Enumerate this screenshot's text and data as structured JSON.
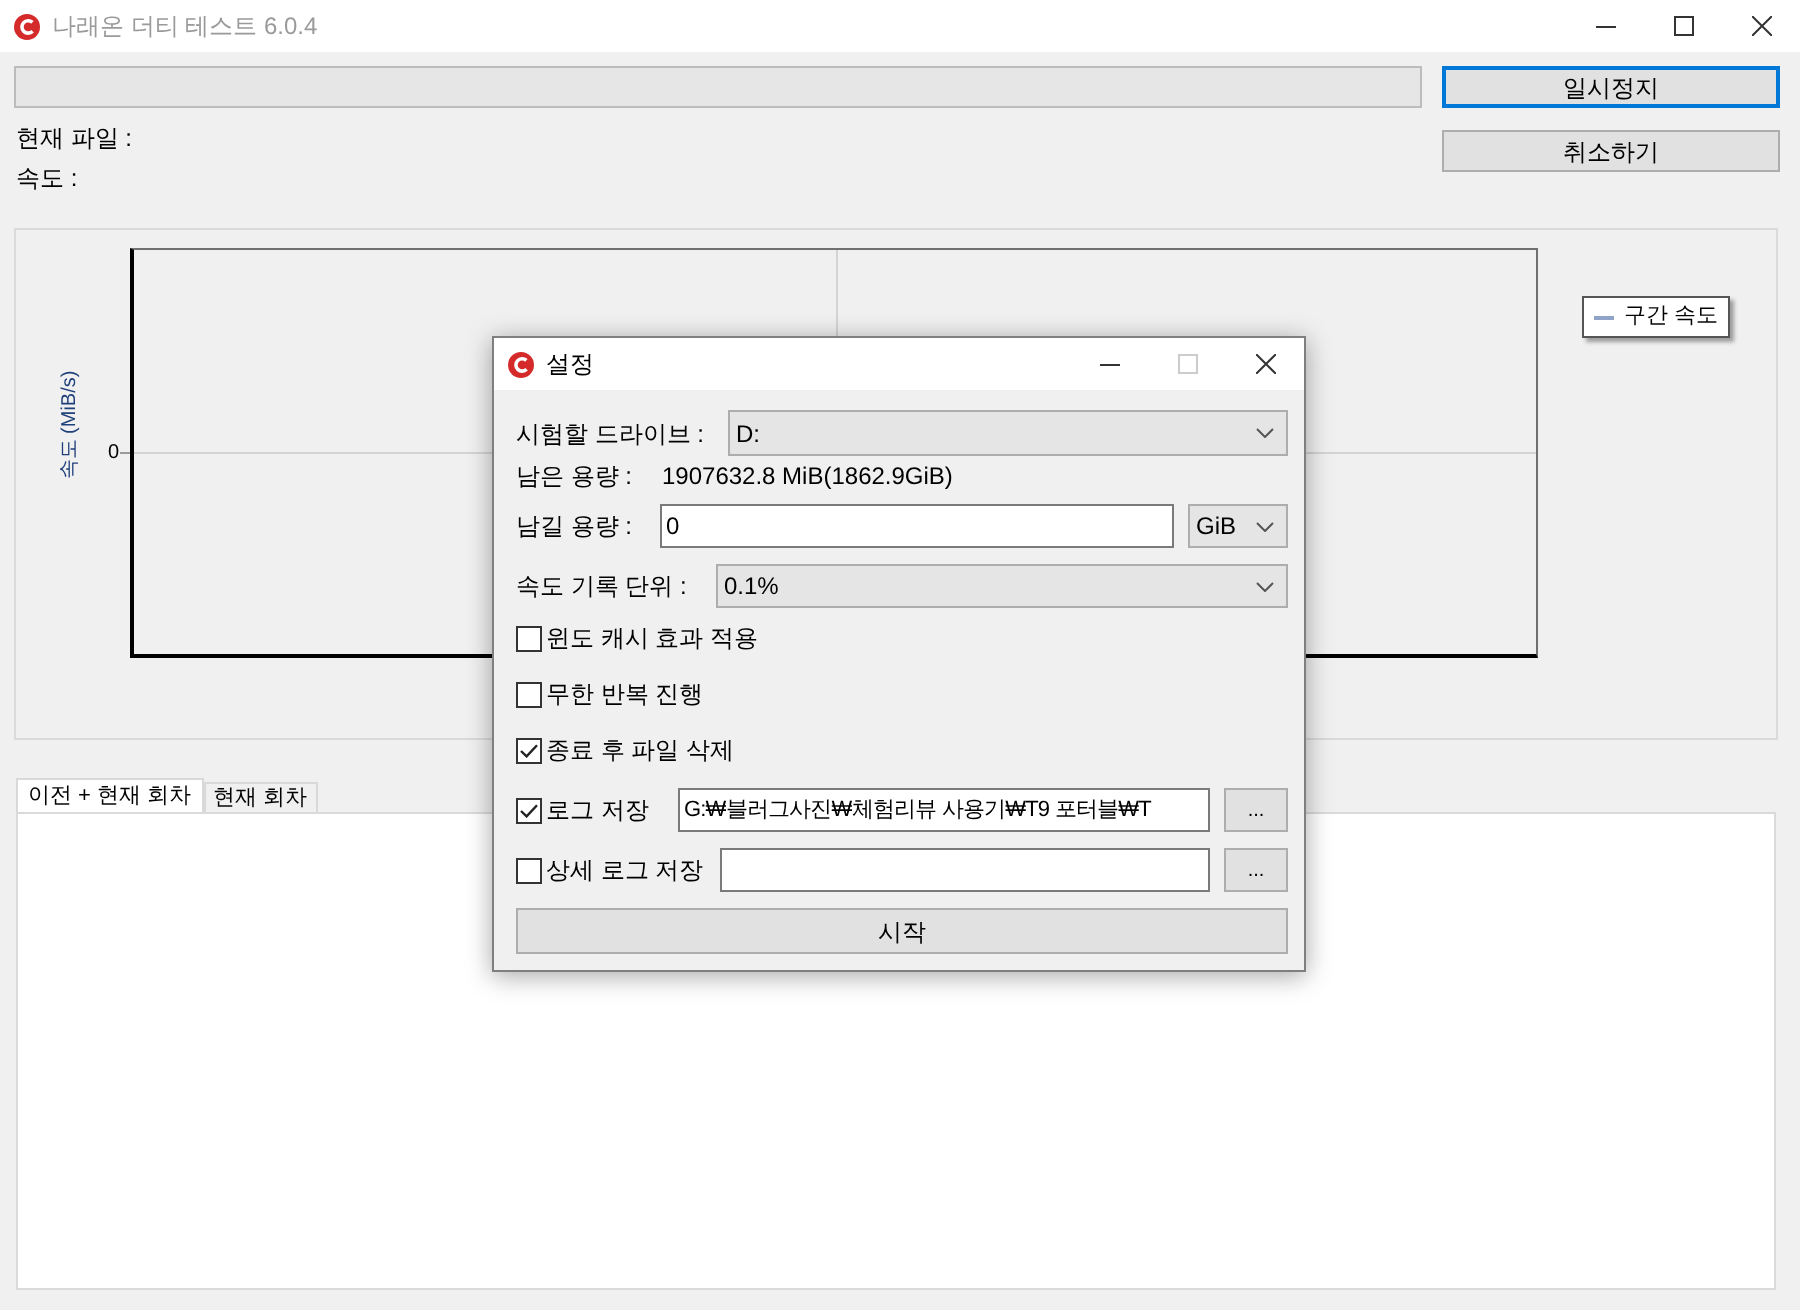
{
  "window": {
    "title": "나래온 더티 테스트 6.0.4",
    "controls": [
      {
        "kind": "minimize",
        "disabled": false
      },
      {
        "kind": "maximize",
        "disabled": false
      },
      {
        "kind": "close",
        "disabled": false
      }
    ]
  },
  "progress": {
    "level": 0
  },
  "buttons": [
    {
      "label": "일시정지",
      "focused": true
    },
    {
      "label": "취소하기",
      "focused": false
    }
  ],
  "status_lines": [
    "현재 파일 :",
    "속도 :"
  ],
  "chart": {
    "y_axis_label": "속도 (MiB/s)",
    "y_tick": "0",
    "legend": [
      "구간 속도"
    ]
  },
  "tabs": [
    {
      "label": "이전 + 현재 회차",
      "selected": true
    },
    {
      "label": "현재 회차",
      "selected": false
    }
  ],
  "dialog": {
    "title": "설정",
    "controls": [
      {
        "kind": "minimize",
        "disabled": false
      },
      {
        "kind": "maximize",
        "disabled": true
      },
      {
        "kind": "close",
        "disabled": false
      }
    ],
    "drive": {
      "label": "시험할 드라이브 :",
      "value": "D:"
    },
    "free_space": {
      "label": "남은 용량 :",
      "value": "1907632.8 MiB(1862.9GiB)"
    },
    "reserve": {
      "label": "남길 용량 :",
      "value": "0",
      "unit": "GiB"
    },
    "log_unit": {
      "label": "속도 기록 단위 :",
      "value": "0.1%"
    },
    "options": [
      {
        "label": "윈도 캐시 효과 적용",
        "checked": false
      },
      {
        "label": "무한 반복 진행",
        "checked": false
      },
      {
        "label": "종료 후 파일 삭제",
        "checked": true
      }
    ],
    "log_paths": [
      {
        "label": "로그 저장",
        "checked": true,
        "value": "G:₩블러그사진₩체험리뷰 사용기₩T9 포터블₩T",
        "browse": "..."
      },
      {
        "label": "상세 로그 저장",
        "checked": false,
        "browse": "..."
      }
    ],
    "start_button": "시작"
  }
}
